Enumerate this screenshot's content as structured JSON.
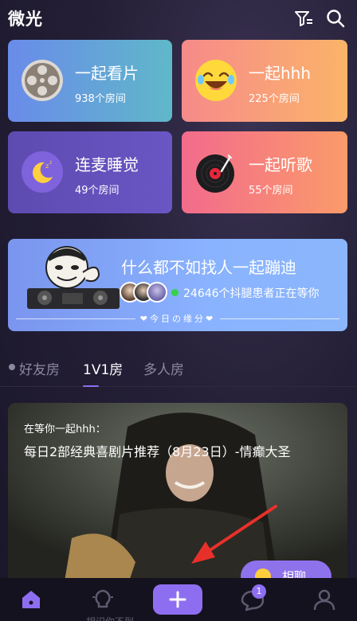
{
  "header": {
    "title": "微光",
    "icons": [
      "filter-icon",
      "search-icon"
    ]
  },
  "categories": [
    {
      "title": "一起看片",
      "subtitle": "938个房间",
      "icon": "film-reel-icon",
      "color": "#6a8bea"
    },
    {
      "title": "一起hhh",
      "subtitle": "225个房间",
      "icon": "laughing-face-icon",
      "color": "#f68a8a"
    },
    {
      "title": "连麦睡觉",
      "subtitle": "49个房间",
      "icon": "moon-icon",
      "color": "#5d4bb0"
    },
    {
      "title": "一起听歌",
      "subtitle": "55个房间",
      "icon": "record-player-icon",
      "color": "#f26b8c"
    }
  ],
  "banner": {
    "title": "什么都不如找人一起蹦迪",
    "status": "24646个抖腿患者正在等你",
    "footer": "❤今日の缘分❤"
  },
  "tabs": [
    {
      "label": "好友房",
      "active": false
    },
    {
      "label": "1V1房",
      "active": true
    },
    {
      "label": "多人房",
      "active": false
    }
  ],
  "room": {
    "caption": "在等你一起hhh：",
    "headline": "每日2部经典喜剧片推荐（8月23日）-情癫大圣",
    "chat_label": "相聊"
  },
  "bottom_nav": {
    "items": [
      "home-icon",
      "lightbulb-icon",
      "add-icon",
      "chat-icon",
      "profile-icon"
    ],
    "chat_badge": "1",
    "peek_text": "相识你不到"
  },
  "colors": {
    "accent": "#8e6ef0",
    "background": "#241f36",
    "online": "#35d14a",
    "annotation": "#e8302a"
  }
}
